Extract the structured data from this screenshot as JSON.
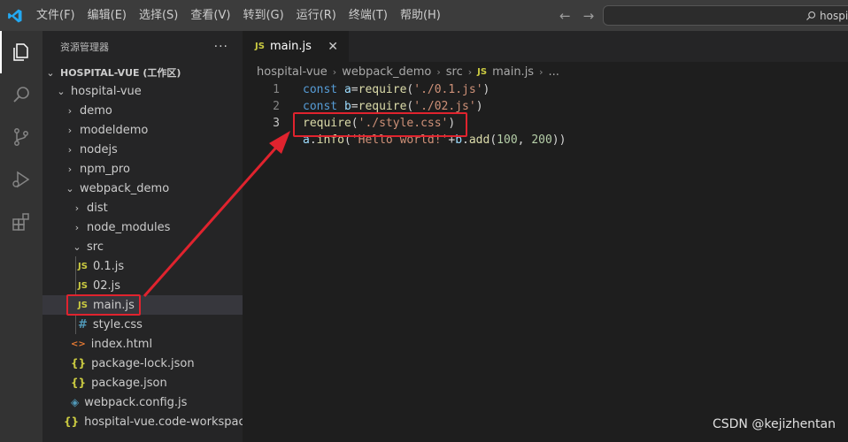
{
  "menu": {
    "items": [
      "文件(F)",
      "编辑(E)",
      "选择(S)",
      "查看(V)",
      "转到(G)",
      "运行(R)",
      "终端(T)",
      "帮助(H)"
    ]
  },
  "command_center": {
    "text": "hospit"
  },
  "sidebar": {
    "title": "资源管理器",
    "more": "···",
    "workspace": "HOSPITAL-VUE (工作区)",
    "tree": [
      {
        "label": "hospital-vue",
        "type": "folder-open"
      },
      {
        "label": "demo",
        "type": "folder"
      },
      {
        "label": "modeldemo",
        "type": "folder"
      },
      {
        "label": "nodejs",
        "type": "folder"
      },
      {
        "label": "npm_pro",
        "type": "folder"
      },
      {
        "label": "webpack_demo",
        "type": "folder-open"
      },
      {
        "label": "dist",
        "type": "folder"
      },
      {
        "label": "node_modules",
        "type": "folder"
      },
      {
        "label": "src",
        "type": "folder-open"
      },
      {
        "label": "0.1.js",
        "type": "js",
        "icon": "JS"
      },
      {
        "label": "02.js",
        "type": "js",
        "icon": "JS"
      },
      {
        "label": "main.js",
        "type": "js",
        "icon": "JS"
      },
      {
        "label": "style.css",
        "type": "css",
        "icon": "#"
      },
      {
        "label": "index.html",
        "type": "html",
        "icon": "<>"
      },
      {
        "label": "package-lock.json",
        "type": "json",
        "icon": "{}"
      },
      {
        "label": "package.json",
        "type": "json",
        "icon": "{}"
      },
      {
        "label": "webpack.config.js",
        "type": "cfg",
        "icon": "◈"
      },
      {
        "label": "hospital-vue.code-workspace",
        "type": "json",
        "icon": "{}"
      }
    ]
  },
  "editor": {
    "tab": {
      "icon": "JS",
      "label": "main.js",
      "close": "✕"
    },
    "breadcrumb": [
      "hospital-vue",
      "webpack_demo",
      "src",
      "main.js",
      "..."
    ],
    "breadcrumb_file_icon": "JS",
    "line_numbers": [
      "1",
      "2",
      "3"
    ]
  },
  "watermark": "CSDN @kejizhentan",
  "colors": {
    "highlight": "#e0232e",
    "accent": "#007acc"
  }
}
